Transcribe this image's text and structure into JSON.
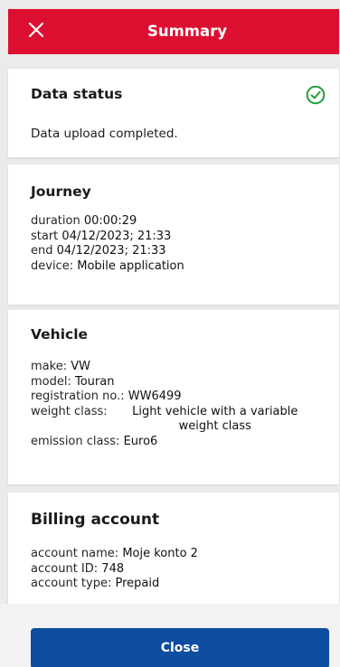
{
  "header": {
    "title": "Summary",
    "close_icon": "close-icon",
    "color": "#dd0f30"
  },
  "data_status": {
    "title": "Data status",
    "message": "Data upload completed.",
    "status_icon": "check-circle-icon",
    "status_color": "#1e9e3a"
  },
  "journey": {
    "title": "Journey",
    "duration_label": "duration",
    "duration_value": "00:00:29",
    "start_label": "start",
    "start_value": "04/12/2023; 21:33",
    "end_label": "end",
    "end_value": "04/12/2023; 21:33",
    "device_label": "device:",
    "device_value": "Mobile application"
  },
  "vehicle": {
    "title": "Vehicle",
    "make_label": "make:",
    "make_value": "VW",
    "model_label": "model:",
    "model_value": "Touran",
    "registration_label": "registration no.:",
    "registration_value": "WW6499",
    "weight_label": "weight class:",
    "weight_value": "Light vehicle with a variable weight class",
    "emission_label": "emission class:",
    "emission_value": "Euro6"
  },
  "billing": {
    "title": "Billing account",
    "name_label": "account name:",
    "name_value": "Moje konto 2",
    "id_label": "account ID:",
    "id_value": "748",
    "type_label": "account type:",
    "type_value": "Prepaid"
  },
  "footer": {
    "close_label": "Close",
    "button_color": "#0d4ea0"
  }
}
